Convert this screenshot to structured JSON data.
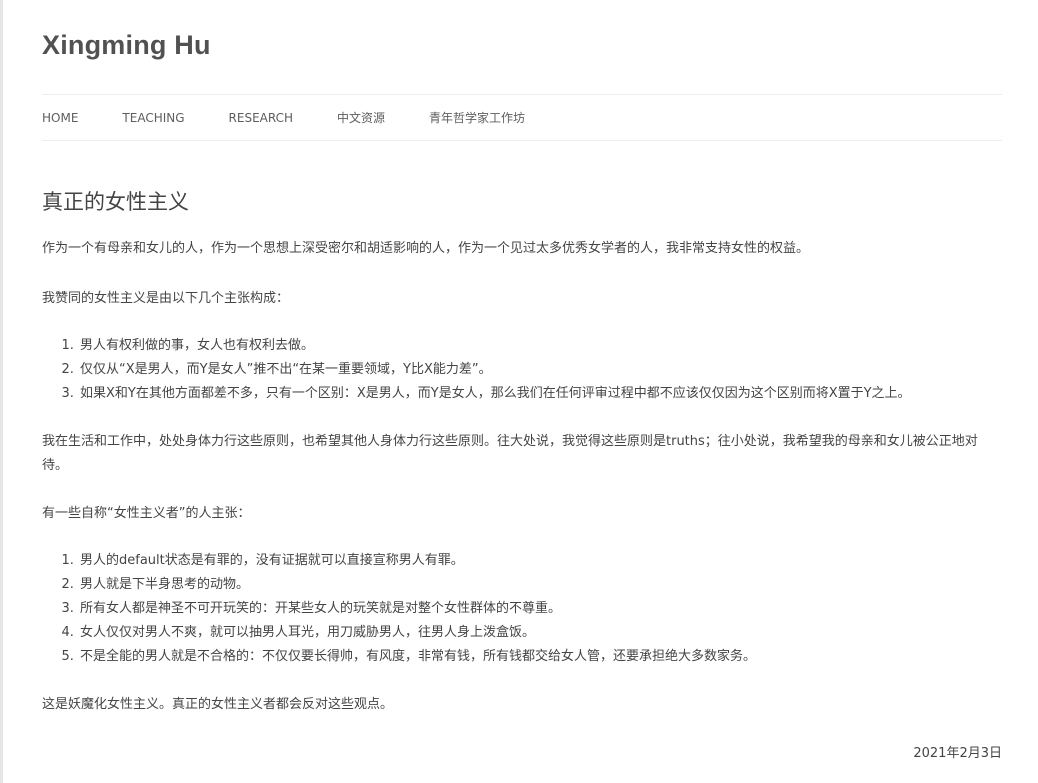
{
  "site": {
    "title": "Xingming Hu"
  },
  "nav": {
    "items": [
      "HOME",
      "TEACHING",
      "RESEARCH",
      "中文资源",
      "青年哲学家工作坊"
    ]
  },
  "post": {
    "title": "真正的女性主义",
    "intro": "作为一个有母亲和女儿的人，作为一个思想上深受密尔和胡适影响的人，作为一个见过太多优秀女学者的人，我非常支持女性的权益。",
    "agree_lead": "我赞同的女性主义是由以下几个主张构成：",
    "agree_list": [
      "男人有权利做的事，女人也有权利去做。",
      "仅仅从“X是男人，而Y是女人”推不出“在某一重要领域，Y比X能力差”。",
      "如果X和Y在其他方面都差不多，只有一个区别：X是男人，而Y是女人，那么我们在任何评审过程中都不应该仅仅因为这个区别而将X置于Y之上。"
    ],
    "practice": "我在生活和工作中，处处身体力行这些原则，也希望其他人身体力行这些原则。往大处说，我觉得这些原则是truths；往小处说，我希望我的母亲和女儿被公正地对待。",
    "others_lead": "有一些自称“女性主义者”的人主张：",
    "others_list": [
      "男人的default状态是有罪的，没有证据就可以直接宣称男人有罪。",
      "男人就是下半身思考的动物。",
      "所有女人都是神圣不可开玩笑的：开某些女人的玩笑就是对整个女性群体的不尊重。",
      "女人仅仅对男人不爽，就可以抽男人耳光，用刀威胁男人，往男人身上泼盒饭。",
      "不是全能的男人就是不合格的：不仅仅要长得帅，有风度，非常有钱，所有钱都交给女人管，还要承担绝大多数家务。"
    ],
    "conclusion": "这是妖魔化女性主义。真正的女性主义者都会反对这些观点。",
    "date": "2021年2月3日"
  }
}
